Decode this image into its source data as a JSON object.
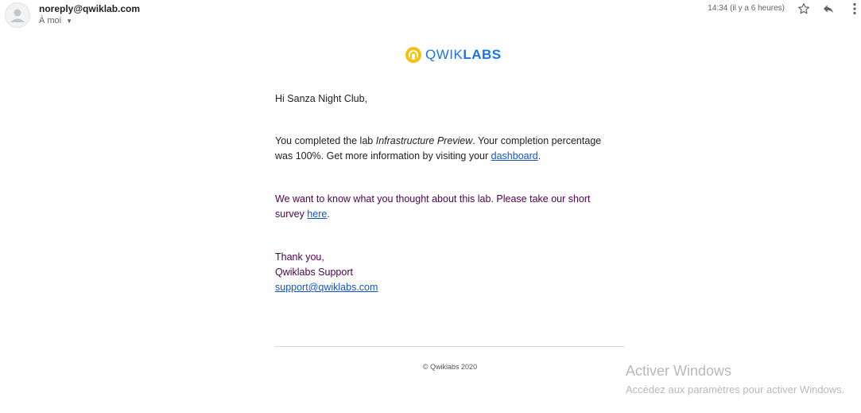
{
  "header": {
    "sender": "noreply@qwiklab.com",
    "recipient": "À moi",
    "timestamp": "14:34 (il y a 6 heures)",
    "icons": [
      "person-icon",
      "star-icon",
      "reply-icon",
      "more-vert-icon"
    ]
  },
  "logo": {
    "text_light": "QWIK",
    "text_bold": "LABS",
    "color": "#1a73e8",
    "icon_color": "#f4c20d"
  },
  "email": {
    "greeting": "Hi Sanza Night Club,",
    "completed_prefix": "You completed the lab ",
    "lab_name": "Infrastructure Preview",
    "completed_middle": ". Your completion percentage was 100%. Get more information by visiting your ",
    "dashboard_link": "dashboard",
    "completed_suffix": ".",
    "survey_prefix": "We want to know what you thought about this lab. Please take our short survey ",
    "survey_link": "here",
    "survey_suffix": ".",
    "thanks": "Thank you,",
    "team": "Qwiklabs Support",
    "support_email": "support@qwiklabs.com",
    "footer": "© Qwiklabs 2020"
  },
  "watermark": {
    "title": "Activer Windows",
    "subtitle": "Accédez aux paramètres pour activer Windows."
  },
  "colors": {
    "link": "#1155cc",
    "quoted_text": "#500050",
    "muted": "#5f6368"
  }
}
